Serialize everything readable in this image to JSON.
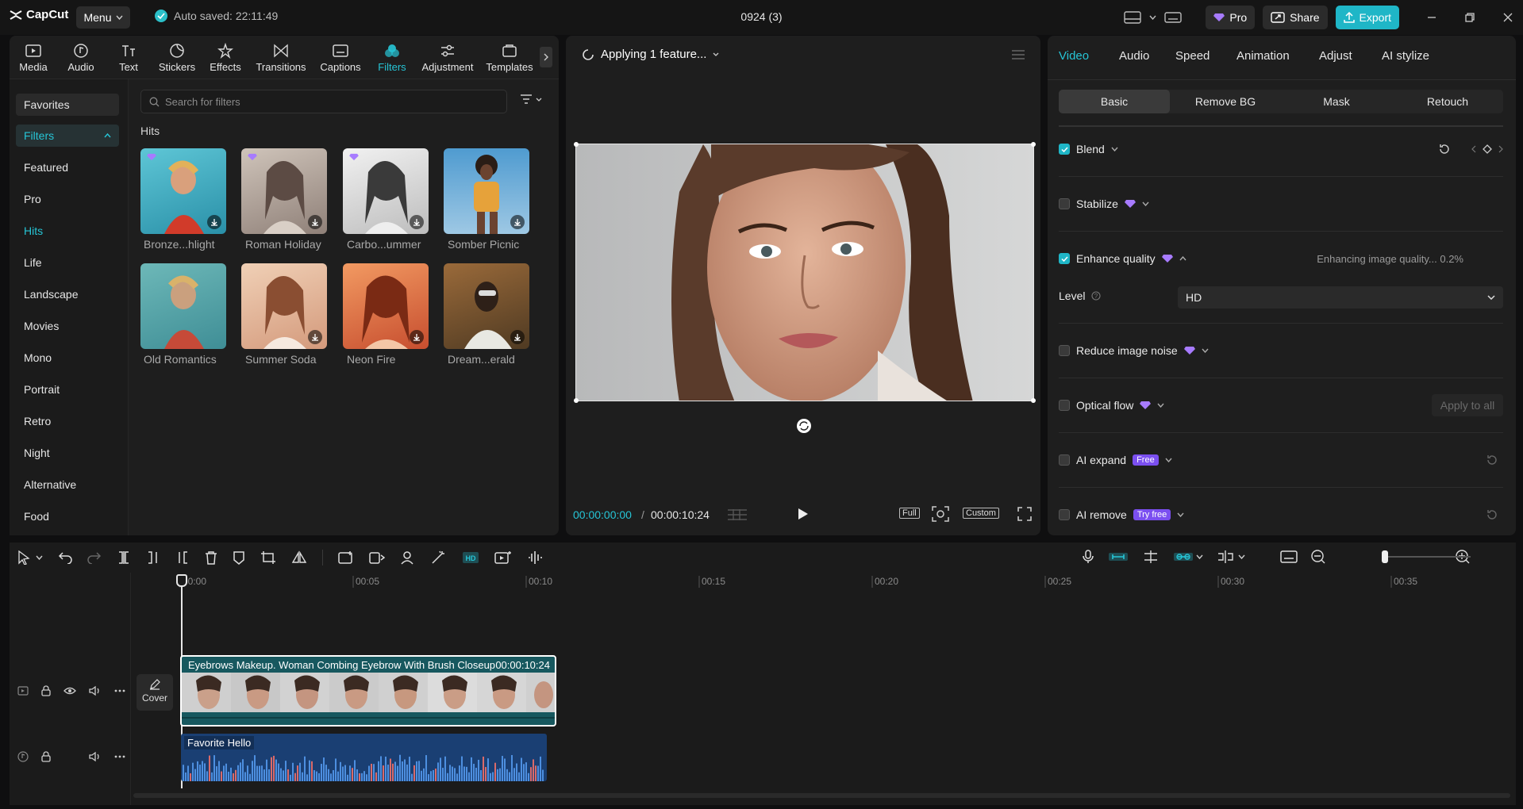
{
  "app": {
    "logo": "CapCut",
    "menu_label": "Menu",
    "autosave": "Auto saved: 22:11:49",
    "project_title": "0924 (3)"
  },
  "top_right": {
    "pro": "Pro",
    "share": "Share",
    "export": "Export"
  },
  "tools": [
    {
      "label": "Media",
      "icon": "media-icon"
    },
    {
      "label": "Audio",
      "icon": "audio-icon"
    },
    {
      "label": "Text",
      "icon": "text-icon"
    },
    {
      "label": "Stickers",
      "icon": "stickers-icon"
    },
    {
      "label": "Effects",
      "icon": "effects-icon"
    },
    {
      "label": "Transitions",
      "icon": "transitions-icon"
    },
    {
      "label": "Captions",
      "icon": "captions-icon"
    },
    {
      "label": "Filters",
      "icon": "filters-icon",
      "active": true
    },
    {
      "label": "Adjustment",
      "icon": "adjustment-icon"
    },
    {
      "label": "Templates",
      "icon": "templates-icon"
    }
  ],
  "sidebar": {
    "favorites": "Favorites",
    "filters": "Filters",
    "items": [
      "Featured",
      "Pro",
      "Hits",
      "Life",
      "Landscape",
      "Movies",
      "Mono",
      "Portrait",
      "Retro",
      "Night",
      "Alternative",
      "Food"
    ],
    "active": "Hits"
  },
  "filter_search": {
    "placeholder": "Search for filters"
  },
  "section_title": "Hits",
  "thumbnails": [
    {
      "label": "Bronze...hlight",
      "bg": "#3aa4b5",
      "pro": true
    },
    {
      "label": "Roman Holiday",
      "bg": "#b9aaa0",
      "pro": true
    },
    {
      "label": "Carbo...ummer",
      "bg": "#d8d8d8",
      "pro": true
    },
    {
      "label": "Somber Picnic",
      "bg": "#4d8fb8",
      "pro": false
    },
    {
      "label": "Old Romantics",
      "bg": "#5aa3a8",
      "pro": false
    },
    {
      "label": "Summer Soda",
      "bg": "#e6b79a",
      "pro": false
    },
    {
      "label": "Neon Fire",
      "bg": "#e07a52",
      "pro": false
    },
    {
      "label": "Dream...erald",
      "bg": "#7a5a3a",
      "pro": false
    }
  ],
  "player": {
    "status": "Applying 1 feature...",
    "timecode": "00:00:00:00",
    "duration": "00:00:10:24",
    "full": "Full",
    "custom": "Custom"
  },
  "right_panel": {
    "tabs": [
      "Video",
      "Audio",
      "Speed",
      "Animation",
      "Adjust",
      "AI stylize"
    ],
    "active_tab": "Video",
    "subtabs": [
      "Basic",
      "Remove BG",
      "Mask",
      "Retouch"
    ],
    "active_subtab": "Basic",
    "blend": "Blend",
    "stabilize": "Stabilize",
    "enhance_quality": "Enhance quality",
    "enhance_status": "Enhancing image quality... 0.2%",
    "level_label": "Level",
    "level_value": "HD",
    "reduce_noise": "Reduce image noise",
    "optical_flow": "Optical flow",
    "apply_to_all": "Apply to all",
    "ai_expand": "AI expand",
    "ai_expand_badge": "Free",
    "ai_remove": "AI remove",
    "ai_remove_badge": "Try free"
  },
  "timeline": {
    "ruler": [
      "00:00",
      "00:05",
      "00:10",
      "00:15",
      "00:20",
      "00:25",
      "00:30",
      "00:35"
    ],
    "cover": "Cover",
    "video_clip_title": "Eyebrows Makeup. Woman Combing Eyebrow With Brush Closeup",
    "video_clip_duration": "00:00:10:24",
    "audio_clip_title": "Favorite Hello"
  },
  "colors": {
    "accent": "#1fb6c7",
    "pro_purple": "#7b4ff0"
  }
}
